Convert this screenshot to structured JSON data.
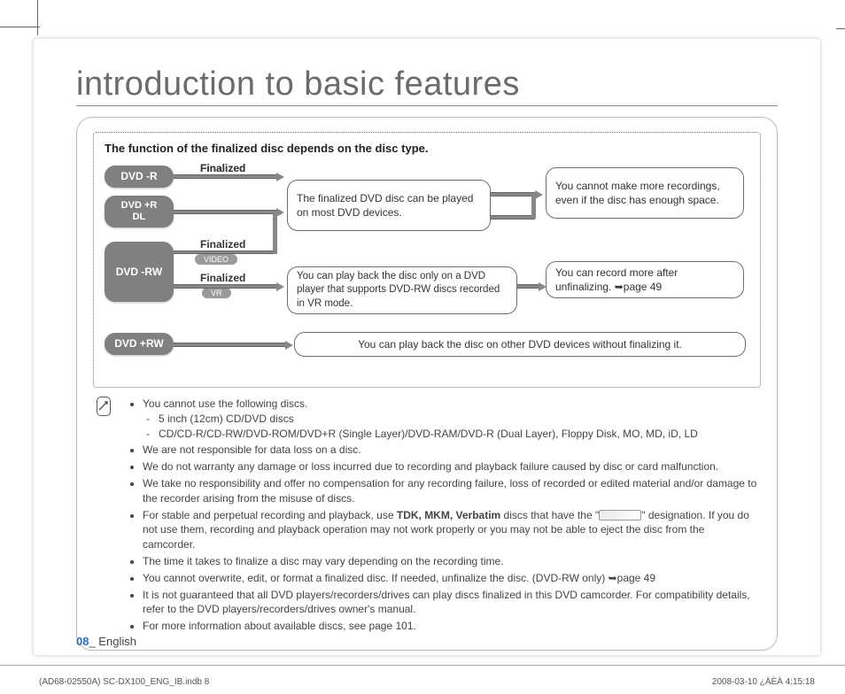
{
  "title": "introduction to basic features",
  "panel_heading": "The function of the finalized disc depends on the disc type.",
  "pills": {
    "dvd_r": "DVD -R",
    "dvd_r_dl": "DVD +R\nDL",
    "dvd_rw": "DVD -RW",
    "dvd_plus_rw": "DVD +RW"
  },
  "labels": {
    "finalized": "Finalized",
    "video": "VIDEO",
    "vr": "VR"
  },
  "boxes": {
    "box1": "The finalized DVD disc can be played on most DVD devices.",
    "box2": "You can play back the disc only on a DVD player that supports DVD-RW discs recorded in VR mode.",
    "box3": "You can play back the disc on other DVD devices without finalizing it.",
    "box4": "You cannot make more recordings, even if the disc has enough space.",
    "box5_a": "You can record more after unfinalizing. ",
    "box5_b": "➥page 49"
  },
  "notes": [
    "You cannot use the following discs.",
    "We are not responsible for data loss on a disc.",
    "We do not warranty any damage or loss incurred due to recording and playback failure caused by disc or card malfunction.",
    "We take no responsibility and offer no compensation for any recording failure, loss of recorded or edited material and/or damage to the recorder arising from the misuse of discs.",
    "For stable and perpetual recording and playback, use TDK, MKM, Verbatim discs that have the \" \" designation. If you do not use them, recording and playback operation may not work properly or you may not be able to eject the disc from the camcorder.",
    "The time it takes to finalize a disc may vary depending on the recording time.",
    "You cannot overwrite, edit, or format a finalized disc. If needed, unfinalize the disc. (DVD-RW only) ➥page 49",
    "It is not guaranteed that all DVD players/recorders/drives can play discs finalized in this DVD camcorder. For compatibility details, refer to the DVD players/recorders/drives owner's manual.",
    "For more information about available discs, see page 101."
  ],
  "sub_notes": [
    "5 inch (12cm) CD/DVD discs",
    "CD/CD-R/CD-RW/DVD-ROM/DVD+R (Single Layer)/DVD-RAM/DVD-R (Dual Layer), Floppy Disk, MO, MD, iD, LD"
  ],
  "highlight": "TDK, MKM, Verbatim",
  "page_num": "08",
  "page_lang": "_ English",
  "doc_footer_left": "(AD68-02550A) SC-DX100_ENG_IB.indb   8",
  "doc_footer_right": "2008-03-10   ¿ÀÈÄ 4:15:18"
}
